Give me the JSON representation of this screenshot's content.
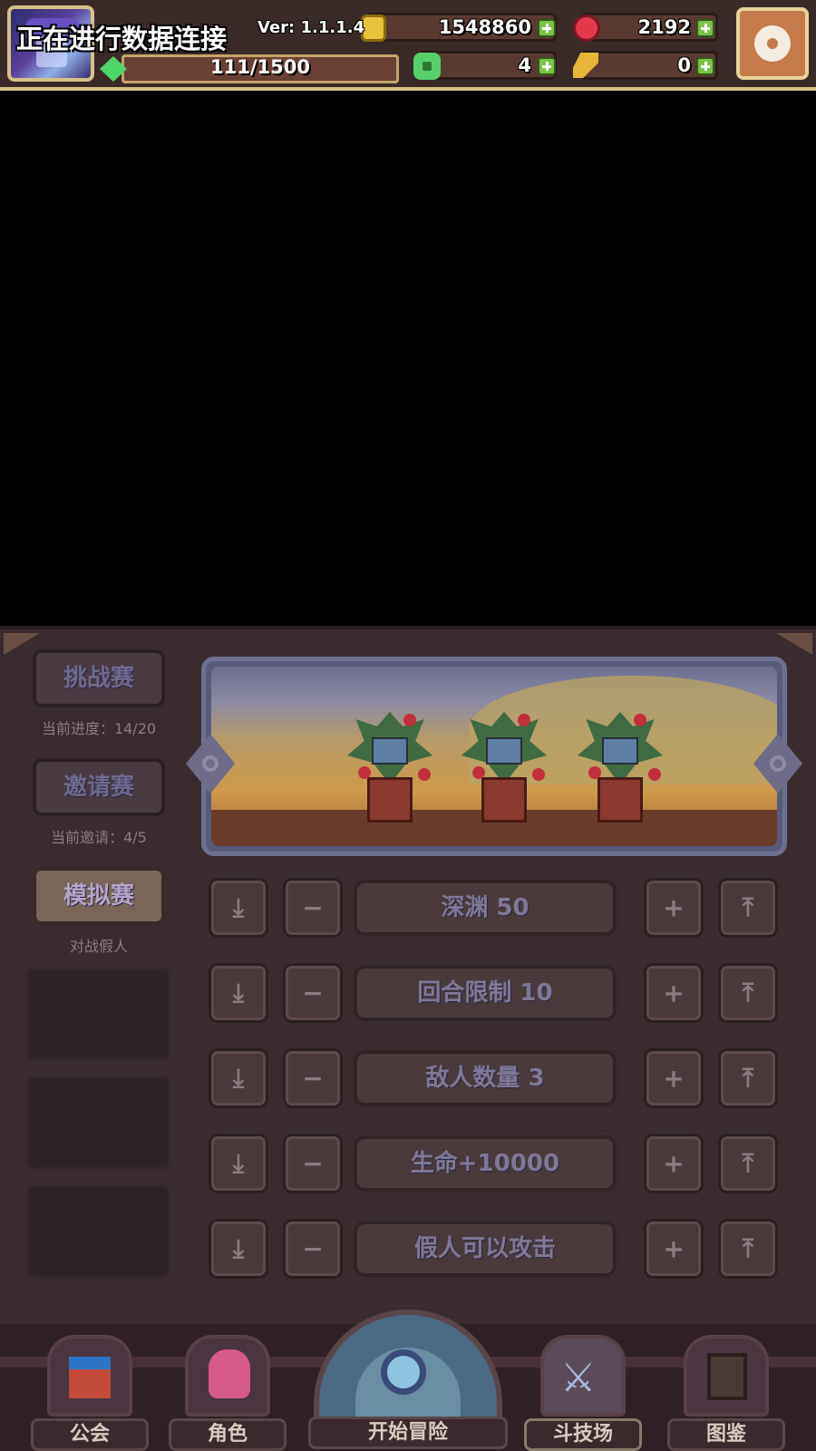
{
  "hud": {
    "status_text": "正在进行数据连接",
    "version": "Ver: 1.1.1.4",
    "gold": "1548860",
    "gems": "2192",
    "stamina": "111/1500",
    "clover": "4",
    "keys": "0",
    "colors": {
      "hud_bg": "#3a2a27",
      "hud_border": "#d8c08a",
      "plus": "#7ec24a"
    },
    "icons": [
      "avatar-portrait",
      "gold-coin-icon",
      "red-gem-icon",
      "green-stamina-icon",
      "clover-icon",
      "key-icon",
      "gear-icon"
    ]
  },
  "sidebar": {
    "modes": [
      {
        "label": "挑战赛",
        "sub": "当前进度：14/20",
        "active": false
      },
      {
        "label": "邀请赛",
        "sub": "当前邀请：4/5",
        "active": false
      },
      {
        "label": "模拟赛",
        "sub": "对战假人",
        "active": true
      }
    ]
  },
  "preview": {
    "enemy_count_shown": 3,
    "icons": [
      "left-arrow-icon",
      "right-arrow-icon",
      "tree-monster-sprite"
    ]
  },
  "options": [
    {
      "label": "深渊 50"
    },
    {
      "label": "回合限制 10"
    },
    {
      "label": "敌人数量 3"
    },
    {
      "label": "生命+10000"
    },
    {
      "label": "假人可以攻击"
    }
  ],
  "option_button_symbols": {
    "to_min": "⤓",
    "minus": "−",
    "plus": "+",
    "to_max": "⤒"
  },
  "nav": {
    "guild": "公会",
    "character": "角色",
    "adventure": "开始冒险",
    "arena": "斗技场",
    "codex": "图鉴"
  }
}
